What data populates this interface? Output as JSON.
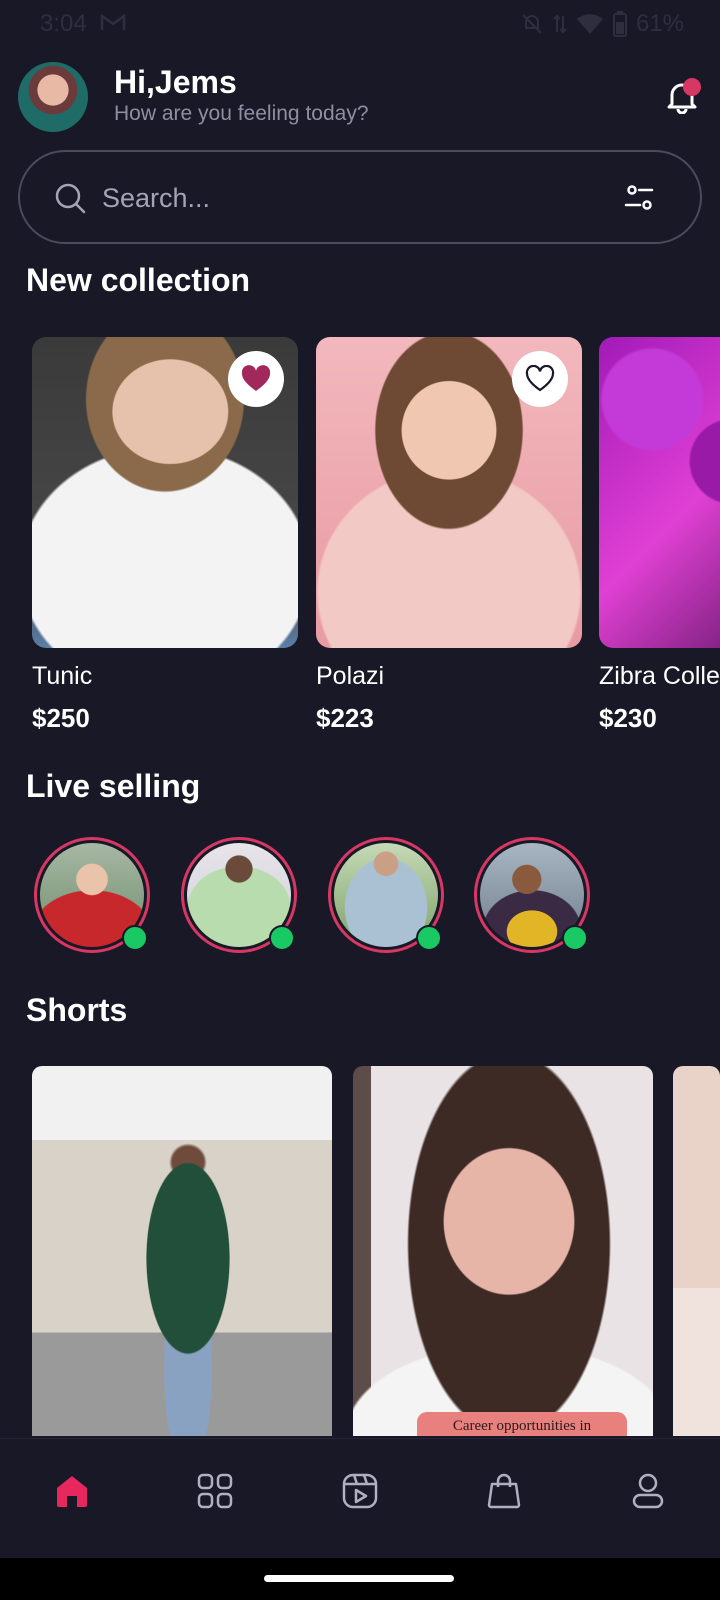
{
  "status_bar": {
    "time": "3:04",
    "battery": "61%",
    "icons": [
      "gmail-icon",
      "mute-icon",
      "data-icon",
      "wifi-icon",
      "battery-icon"
    ]
  },
  "header": {
    "greeting": "Hi,Jems",
    "subtitle": "How are you feeling today?",
    "notification_icon": "bell-icon"
  },
  "search": {
    "placeholder": "Search...",
    "icon": "search-icon",
    "filter_icon": "filter-icon"
  },
  "new_collection": {
    "title": "New collection",
    "items": [
      {
        "name": "Tunic",
        "price": "$250",
        "favorited": true
      },
      {
        "name": "Polazi",
        "price": "$223",
        "favorited": false
      },
      {
        "name": "Zibra Colle",
        "price": "$230",
        "favorited": false
      }
    ]
  },
  "live_selling": {
    "title": "Live selling",
    "count": 4
  },
  "shorts": {
    "title": "Shorts",
    "items": [
      {
        "caption": ""
      },
      {
        "caption": "Career opportunities in"
      },
      {
        "caption": ""
      }
    ]
  },
  "bottom_nav": {
    "items": [
      "home-icon",
      "categories-icon",
      "shorts-icon",
      "bag-icon",
      "profile-icon"
    ],
    "active": "home-icon"
  },
  "colors": {
    "background": "#181827",
    "accent": "#d63863",
    "online": "#18c964",
    "muted_text": "#8d8fa2"
  }
}
